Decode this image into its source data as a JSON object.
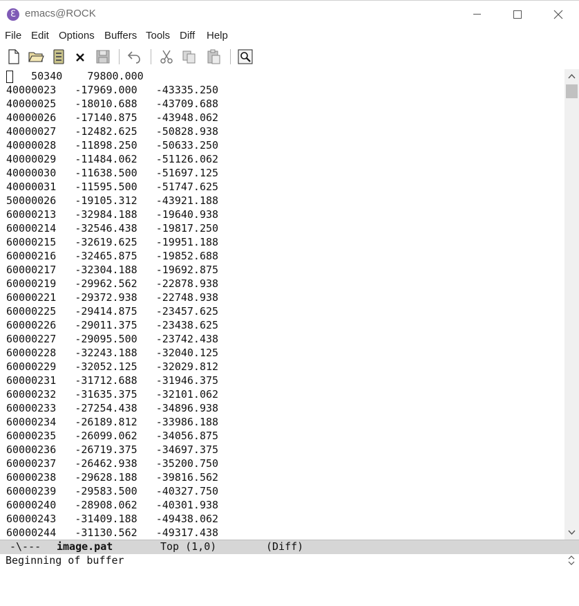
{
  "window": {
    "title": "emacs@ROCK",
    "app_icon": "emacs-icon"
  },
  "menubar": {
    "items": [
      "File",
      "Edit",
      "Options",
      "Buffers",
      "Tools",
      "Diff",
      "Help"
    ]
  },
  "toolbar": {
    "icons": [
      "new-file-icon",
      "open-folder-icon",
      "open-directory-icon",
      "close-icon",
      "save-icon",
      "undo-icon",
      "cut-icon",
      "copy-icon",
      "paste-icon",
      "search-icon"
    ]
  },
  "buffer": {
    "lines": [
      "    50340    79800.000",
      "40000023   -17969.000   -43335.250",
      "40000025   -18010.688   -43709.688",
      "40000026   -17140.875   -43948.062",
      "40000027   -12482.625   -50828.938",
      "40000028   -11898.250   -50633.250",
      "40000029   -11484.062   -51126.062",
      "40000030   -11638.500   -51697.125",
      "40000031   -11595.500   -51747.625",
      "50000026   -19105.312   -43921.188",
      "60000213   -32984.188   -19640.938",
      "60000214   -32546.438   -19817.250",
      "60000215   -32619.625   -19951.188",
      "60000216   -32465.875   -19852.688",
      "60000217   -32304.188   -19692.875",
      "60000219   -29962.562   -22878.938",
      "60000221   -29372.938   -22748.938",
      "60000225   -29414.875   -23457.625",
      "60000226   -29011.375   -23438.625",
      "60000227   -29095.500   -23742.438",
      "60000228   -32243.188   -32040.125",
      "60000229   -32052.125   -32029.812",
      "60000231   -31712.688   -31946.375",
      "60000232   -31635.375   -32101.062",
      "60000233   -27254.438   -34896.938",
      "60000234   -26189.812   -33986.188",
      "60000235   -26099.062   -34056.875",
      "60000236   -26719.375   -34697.375",
      "60000237   -26462.938   -35200.750",
      "60000238   -29628.188   -39816.562",
      "60000239   -29583.500   -40327.750",
      "60000240   -28908.062   -40301.938",
      "60000243   -31409.188   -49438.062",
      "60000244   -31130.562   -49317.438"
    ]
  },
  "modeline": {
    "status": "-\\---",
    "buffer_name": "image.pat",
    "position": "Top (1,0)",
    "mode": "(Diff)"
  },
  "minibuffer": {
    "message": "Beginning of buffer"
  }
}
